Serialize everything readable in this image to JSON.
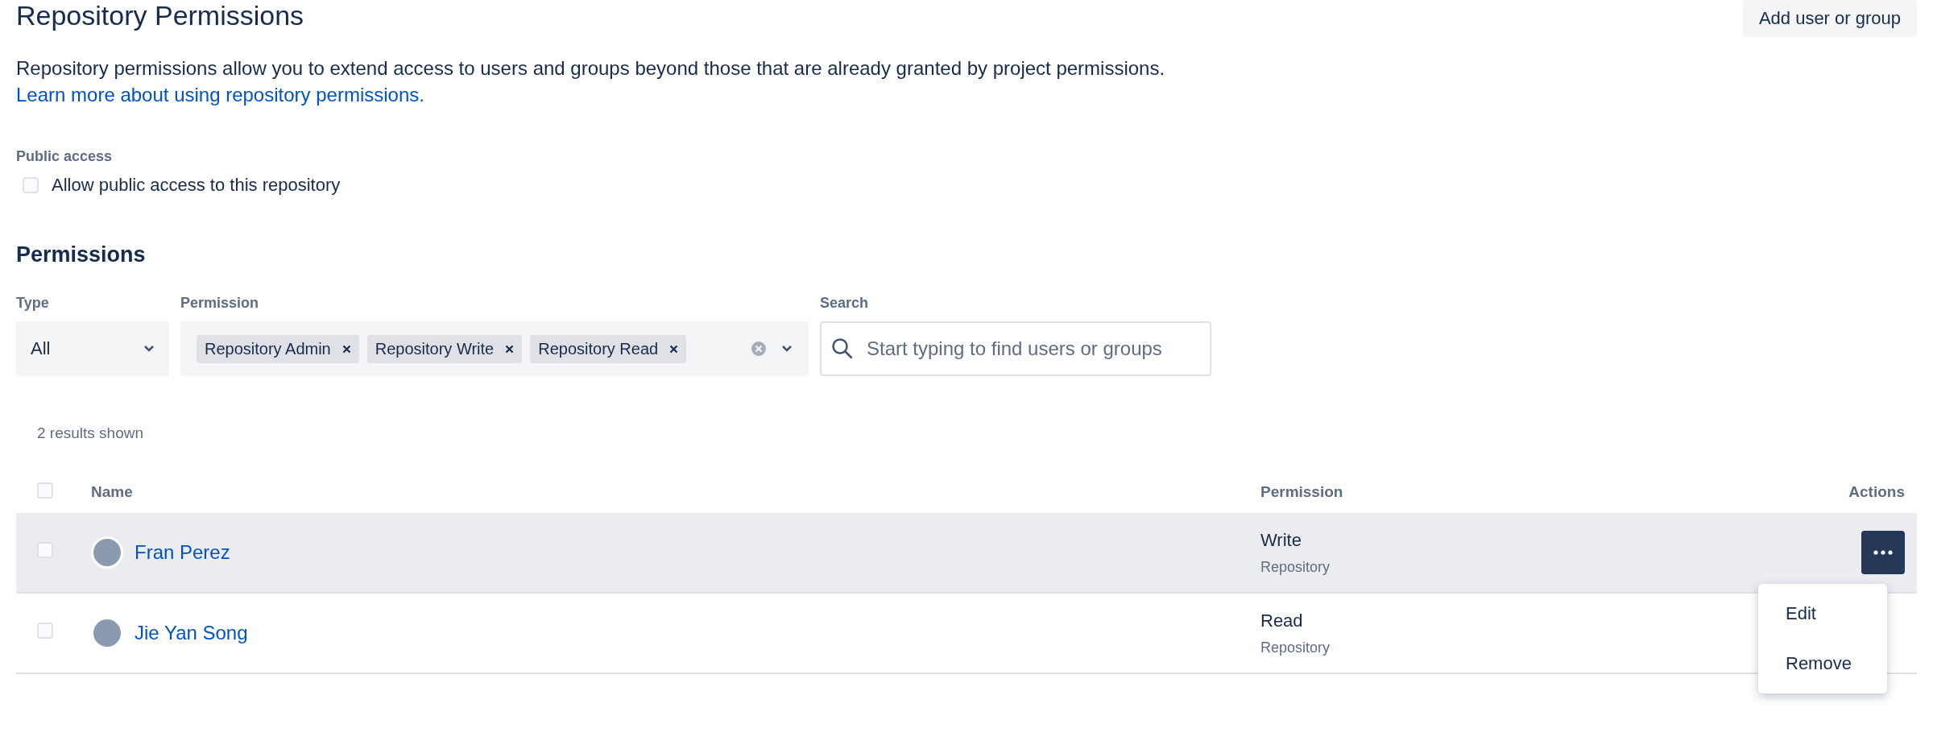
{
  "header": {
    "title": "Repository Permissions",
    "button": "Add user or group"
  },
  "description": {
    "text": "Repository permissions allow you to extend access to users and groups beyond those that are already granted by project permissions.",
    "link": "Learn more about using repository permissions."
  },
  "public_access": {
    "label": "Public access",
    "checkbox": {
      "label": "Allow public access to this repository",
      "checked": false
    }
  },
  "permissions": {
    "title": "Permissions",
    "filters": {
      "type": {
        "label": "Type",
        "value": "All"
      },
      "permission": {
        "label": "Permission",
        "tags": [
          "Repository Admin",
          "Repository Write",
          "Repository Read"
        ]
      },
      "search": {
        "label": "Search",
        "placeholder": "Start typing to find users or groups"
      }
    },
    "results": "2 results shown",
    "table": {
      "select_all_checked": false,
      "columns": [
        "Name",
        "Permission",
        "Actions"
      ],
      "rows": [
        {
          "name": "Fran Perez",
          "permission": "Write",
          "scope": "Repository",
          "checked": false,
          "highlighted": true
        },
        {
          "name": "Jie Yan Song",
          "permission": "Read",
          "scope": "Repository",
          "checked": false,
          "highlighted": false
        }
      ]
    },
    "actions_menu": {
      "open": true,
      "items": [
        "Edit",
        "Remove"
      ]
    }
  }
}
